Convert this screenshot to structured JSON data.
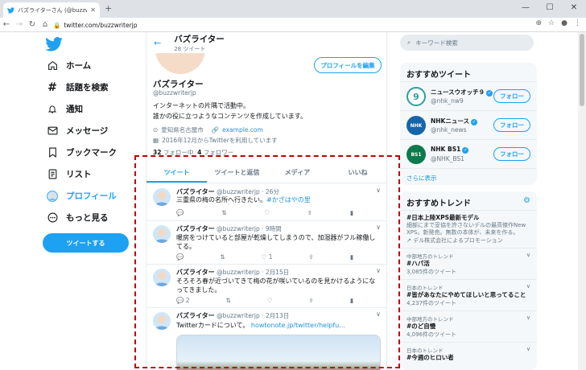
{
  "browser": {
    "tab_title": "バズライターさん (@buzzwriterjp) / Twitter",
    "url": "twitter.com/buzzwriterjp"
  },
  "sidebar": {
    "items": [
      {
        "label": "ホーム",
        "icon": "home-icon"
      },
      {
        "label": "話題を検索",
        "icon": "hashtag-icon"
      },
      {
        "label": "通知",
        "icon": "bell-icon"
      },
      {
        "label": "メッセージ",
        "icon": "mail-icon"
      },
      {
        "label": "ブックマーク",
        "icon": "bookmark-icon"
      },
      {
        "label": "リスト",
        "icon": "list-icon"
      },
      {
        "label": "プロフィール",
        "icon": "avatar-icon"
      },
      {
        "label": "もっと見る",
        "icon": "more-icon"
      }
    ],
    "tweet_button": "ツイートする"
  },
  "profile": {
    "header_name": "バズライター",
    "tweet_count": "28 ツイート",
    "edit_button": "プロフィールを編集",
    "name": "バズライター",
    "handle": "@buzzwriterjp",
    "bio_line1": "インターネットの片隅で活動中。",
    "bio_line2": "誰かの役に立つようなコンテンツを作成しています。",
    "location": "愛知県名古屋市",
    "website": "example.com",
    "joined": "2016年12月からTwitterを利用しています",
    "following_count": "32",
    "following_label": "フォロー中",
    "followers_count": "4",
    "followers_label": "フォロワー"
  },
  "tabs": [
    "ツイート",
    "ツイートと返信",
    "メディア",
    "いいね"
  ],
  "tweets": [
    {
      "name": "バズライター",
      "handle": "@buzzwriterjp",
      "time": "· 26分",
      "text": "三重県の梅の名所へ行きたい。",
      "hashtag": "#かざはやの里",
      "reply": "",
      "retweet": "",
      "like": ""
    },
    {
      "name": "バズライター",
      "handle": "@buzzwriterjp",
      "time": "· 9時間",
      "text": "暖房をつけていると部屋が乾燥してしまうので、加湿器がフル稼働してる。",
      "hashtag": "",
      "reply": "",
      "retweet": "",
      "like": "1"
    },
    {
      "name": "バズライター",
      "handle": "@buzzwriterjp",
      "time": "· 2月15日",
      "text": "そろそろ春が近づいてきて梅の花が咲いているのを見かけるようになってきました。",
      "hashtag": "",
      "reply": "2",
      "retweet": "",
      "like": ""
    },
    {
      "name": "バズライター",
      "handle": "@buzzwriterjp",
      "time": "· 2月13日",
      "text": "Twitterカードについて。",
      "hashtag": "howtonote.jp/twitter/helpfu...",
      "reply": "",
      "retweet": "",
      "like": ""
    }
  ],
  "right": {
    "search_placeholder": "キーワード検索",
    "recommend_title": "おすすめツイート",
    "accounts": [
      {
        "name": "ニュースウオッチ９",
        "handle": "@nhk_nw9",
        "badge": "9",
        "color": "#2aa198"
      },
      {
        "name": "NHKニュース",
        "handle": "@nhk_news",
        "badge": "NHK",
        "color": "#1565a8"
      },
      {
        "name": "NHK BS1",
        "handle": "@NHK_BS1",
        "badge": "BS1",
        "color": "#0d7a4d"
      }
    ],
    "follow_label": "フォロー",
    "show_more": "さらに表示",
    "trends_title": "おすすめトレンド",
    "trends": [
      {
        "cat": "",
        "title": "#日本上陸XPS最新モデル",
        "desc": "細部にまで妥協を許さないデルの最高傑作New XPS。新発売。無数の本体が、未来を作る。",
        "count": "デル株式会社によるプロモーション"
      },
      {
        "cat": "中部地方のトレンド",
        "title": "#ハパ活",
        "desc": "",
        "count": "3,085件のツイート"
      },
      {
        "cat": "日本のトレンド",
        "title": "#皆があなたにやめてほしいと思ってること",
        "desc": "",
        "count": "4,237件のツイート"
      },
      {
        "cat": "中部地方のトレンド",
        "title": "#のど自慢",
        "desc": "",
        "count": "4,096件のツイート"
      },
      {
        "cat": "日本のトレンド",
        "title": "#今週のヒロい者",
        "desc": "",
        "count": ""
      }
    ]
  }
}
